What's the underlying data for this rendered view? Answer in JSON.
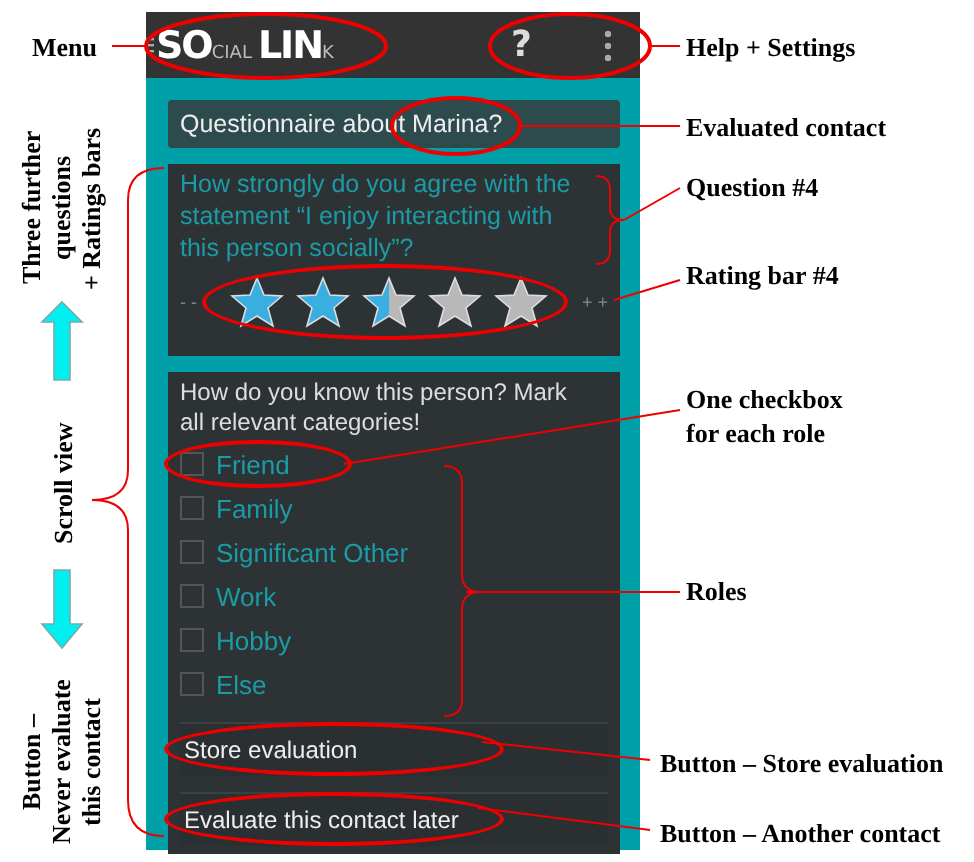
{
  "app_bar": {
    "logo": [
      {
        "text": "SO",
        "kind": "large"
      },
      {
        "text": "CIAL",
        "kind": "small"
      },
      {
        "text": "LIN",
        "kind": "large"
      },
      {
        "text": "K",
        "kind": "small"
      }
    ],
    "help": "?"
  },
  "contact_field": "Questionnaire about Marina?",
  "question": {
    "text": "How strongly do you agree with the statement “I enjoy interacting with this person socially”?",
    "low": "- -",
    "high": "+ +",
    "stars": 2.5
  },
  "roles": {
    "prompt": "How do you know this person? Mark all relevant categories!",
    "options": [
      {
        "label": "Friend",
        "checked": false
      },
      {
        "label": "Family",
        "checked": false
      },
      {
        "label": "Significant Other",
        "checked": false
      },
      {
        "label": "Work",
        "checked": false
      },
      {
        "label": "Hobby",
        "checked": false
      },
      {
        "label": "Else",
        "checked": false
      }
    ]
  },
  "buttons": [
    {
      "label": "Store evaluation"
    },
    {
      "label": "Evaluate this contact later"
    }
  ],
  "annotations": {
    "left": [
      {
        "lines": [
          "Three further",
          "questions",
          "+ Ratings bars"
        ]
      },
      {
        "lines": [
          "Scroll view"
        ]
      },
      {
        "lines": [
          "Button –",
          "Never evaluate",
          "this contact"
        ]
      }
    ],
    "right": [
      {
        "lines": [
          "Menu"
        ]
      },
      {
        "lines": [
          "Help + Settings"
        ]
      },
      {
        "lines": [
          "Evaluated contact"
        ]
      },
      {
        "lines": [
          "Question #4"
        ]
      },
      {
        "lines": [
          "Rating bar #4"
        ]
      },
      {
        "lines": [
          "One checkbox",
          "for each role"
        ]
      },
      {
        "lines": [
          "Roles"
        ]
      },
      {
        "lines": [
          "Button – Store evaluation"
        ]
      },
      {
        "lines": [
          "Button – Another contact"
        ]
      }
    ]
  }
}
